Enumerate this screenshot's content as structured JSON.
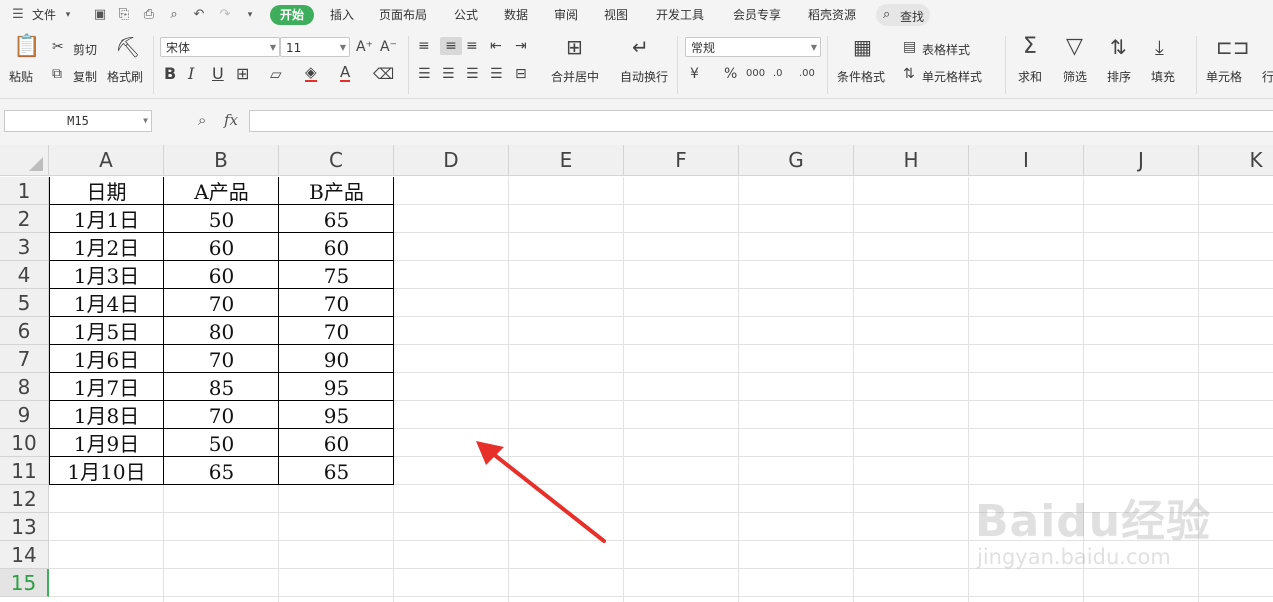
{
  "menubar": {
    "file": "文件",
    "tabs": [
      "开始",
      "插入",
      "页面布局",
      "公式",
      "数据",
      "审阅",
      "视图",
      "开发工具",
      "会员专享",
      "稻壳资源"
    ],
    "search": "查找"
  },
  "ribbon": {
    "paste": "粘贴",
    "cut": "剪切",
    "copy": "复制",
    "format_painter": "格式刷",
    "font_name": "宋体",
    "font_size": "11",
    "merge_center": "合并居中",
    "wrap_text": "自动换行",
    "number_format": "常规",
    "conditional_format": "条件格式",
    "table_style": "表格样式",
    "cell_style": "单元格样式",
    "sum": "求和",
    "filter": "筛选",
    "sort": "排序",
    "fill": "填充",
    "cells": "单元格",
    "rows_cols": "行"
  },
  "formula_bar": {
    "name_box": "M15",
    "fx": "fx",
    "value": ""
  },
  "grid": {
    "columns": [
      "A",
      "B",
      "C",
      "D",
      "E",
      "F",
      "G",
      "H",
      "I",
      "J",
      "K"
    ],
    "rows": [
      "1",
      "2",
      "3",
      "4",
      "5",
      "6",
      "7",
      "8",
      "9",
      "10",
      "11",
      "12",
      "13",
      "14",
      "15"
    ],
    "active_row": "15",
    "table": [
      [
        "日期",
        "A产品",
        "B产品"
      ],
      [
        "1月1日",
        "50",
        "65"
      ],
      [
        "1月2日",
        "60",
        "60"
      ],
      [
        "1月3日",
        "60",
        "75"
      ],
      [
        "1月4日",
        "70",
        "70"
      ],
      [
        "1月5日",
        "80",
        "70"
      ],
      [
        "1月6日",
        "70",
        "90"
      ],
      [
        "1月7日",
        "85",
        "95"
      ],
      [
        "1月8日",
        "70",
        "95"
      ],
      [
        "1月9日",
        "50",
        "60"
      ],
      [
        "1月10日",
        "65",
        "65"
      ]
    ]
  },
  "colors": {
    "accent_green": "#3fae5c",
    "arrow_red": "#e8302a",
    "active_row_text": "#2e9e44"
  },
  "watermark": {
    "brand": "Baidu经验",
    "url": "jingyan.baidu.com"
  }
}
